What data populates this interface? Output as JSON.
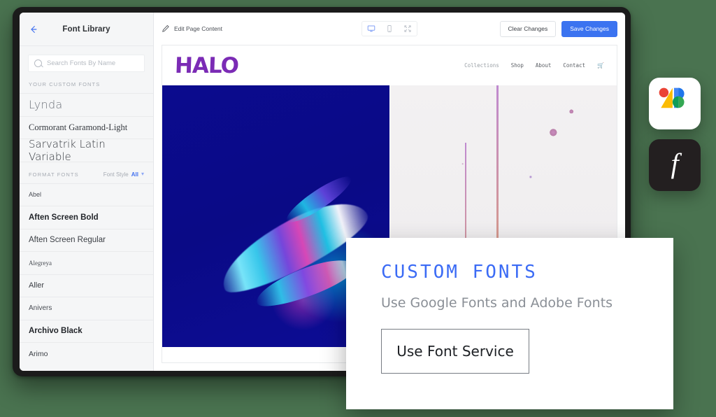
{
  "sidebar": {
    "back_icon": "back-arrow-icon",
    "title": "Font Library",
    "search": {
      "icon": "search-icon",
      "placeholder": "Search Fonts By Name",
      "value": ""
    },
    "custom_section_label": "YOUR CUSTOM FONTS",
    "custom_fonts": [
      {
        "name": "Lynda",
        "style_class": "f-lynda"
      },
      {
        "name": "Cormorant Garamond-Light",
        "style_class": "f-cormorant"
      },
      {
        "name": "Sarvatrik Latin Variable",
        "style_class": "f-sarvatrik"
      }
    ],
    "format_section_label": "FORMAT FONTS",
    "font_style_label": "Font Style",
    "font_style_value": "All",
    "font_style_chevron": "chevron-down-icon",
    "format_fonts": [
      {
        "name": "Abel",
        "style_class": "f-abel"
      },
      {
        "name": "Aften Screen Bold",
        "style_class": "f-aftenb"
      },
      {
        "name": "Aften Screen Regular",
        "style_class": "f-aftenr"
      },
      {
        "name": "Alegreya",
        "style_class": "f-alegreya"
      },
      {
        "name": "Aller",
        "style_class": "f-aller"
      },
      {
        "name": "Anivers",
        "style_class": "f-anivers"
      },
      {
        "name": "Archivo Black",
        "style_class": "f-archivo"
      },
      {
        "name": "Arimo",
        "style_class": "f-arimo"
      }
    ]
  },
  "toolbar": {
    "pencil_icon": "pencil-icon",
    "edit_label": "Edit Page Content",
    "devices": [
      {
        "icon": "desktop-icon",
        "active": true
      },
      {
        "icon": "mobile-icon",
        "active": false
      },
      {
        "icon": "fullscreen-icon",
        "active": false
      }
    ],
    "clear_label": "Clear Changes",
    "save_label": "Save Changes",
    "accent_color": "#3b73f0"
  },
  "preview": {
    "logo": "HALO",
    "logo_color": "#7b2bb5",
    "nav": [
      {
        "label": "Collections",
        "dim": true
      },
      {
        "label": "Shop",
        "dim": false
      },
      {
        "label": "About",
        "dim": false
      },
      {
        "label": "Contact",
        "dim": false
      }
    ],
    "cart_icon": "cart-icon",
    "left_image_alt": "iridescent-liquid-hand-on-navy",
    "left_image_bg": "#0b0b8e",
    "right_image_alt": "purple-orange-liquid-splash-on-white",
    "right_image_bg": "#f0eef0"
  },
  "logos": [
    {
      "id": "google-fonts-logo",
      "name": "Google Fonts"
    },
    {
      "id": "adobe-fonts-logo",
      "name": "Adobe Fonts",
      "glyph": "f"
    }
  ],
  "custom_fonts_card": {
    "title": "CUSTOM FONTS",
    "title_color": "#3b6bf5",
    "subtitle": "Use Google Fonts and Adobe Fonts",
    "button_label": "Use Font Service"
  },
  "page_background": "#4a7350"
}
